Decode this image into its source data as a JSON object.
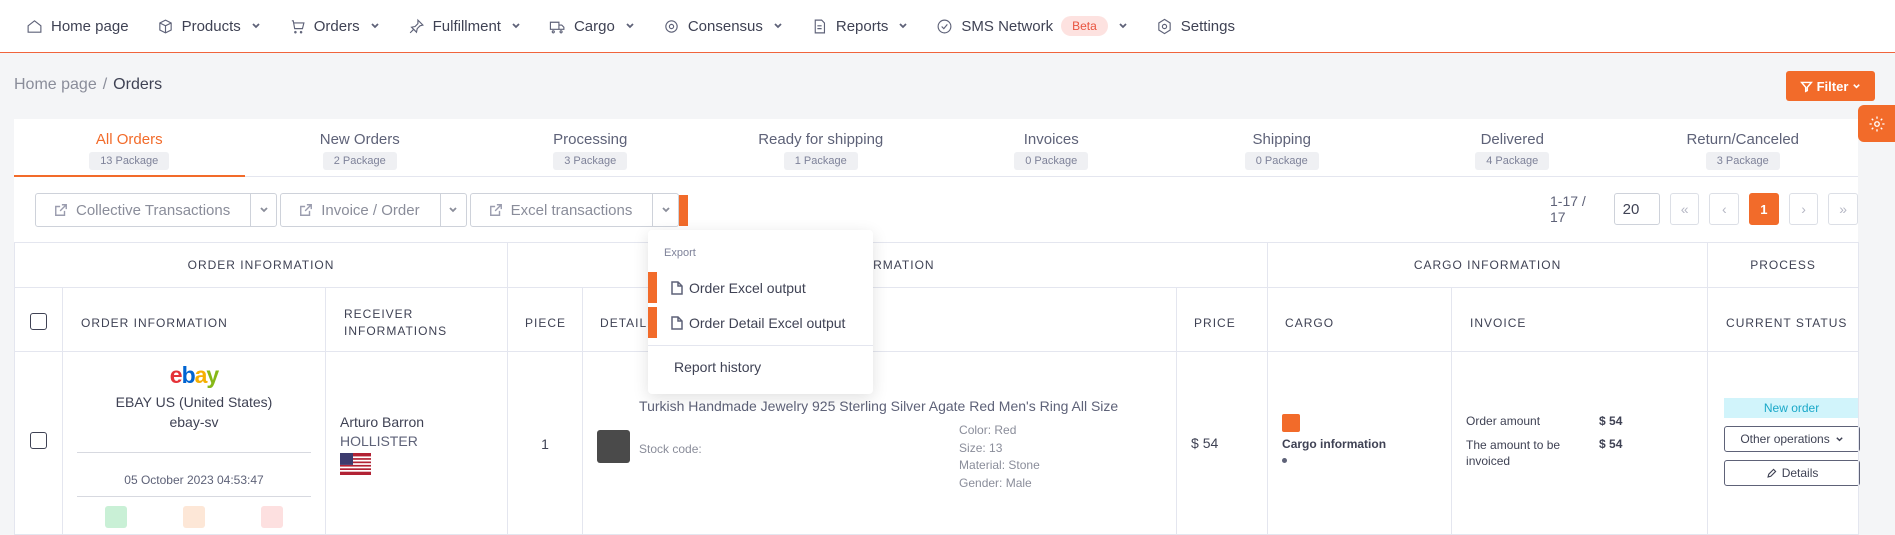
{
  "nav": [
    {
      "label": "Home page",
      "icon": "home-icon",
      "chevron": false
    },
    {
      "label": "Products",
      "icon": "box-icon",
      "chevron": true
    },
    {
      "label": "Orders",
      "icon": "cart-icon",
      "chevron": true
    },
    {
      "label": "Fulfillment",
      "icon": "pin-icon",
      "chevron": true
    },
    {
      "label": "Cargo",
      "icon": "truck-icon",
      "chevron": true
    },
    {
      "label": "Consensus",
      "icon": "target-icon",
      "chevron": true
    },
    {
      "label": "Reports",
      "icon": "report-icon",
      "chevron": true
    },
    {
      "label": "SMS Network",
      "icon": "check-circle-icon",
      "chevron": true,
      "badge": "Beta"
    },
    {
      "label": "Settings",
      "icon": "settings-icon",
      "chevron": false
    }
  ],
  "breadcrumb": {
    "home": "Home page",
    "sep": "/",
    "current": "Orders"
  },
  "filter_label": "Filter",
  "tabs": [
    {
      "label": "All Orders",
      "count": "13 Package",
      "active": true
    },
    {
      "label": "New Orders",
      "count": "2 Package"
    },
    {
      "label": "Processing",
      "count": "3 Package"
    },
    {
      "label": "Ready for shipping",
      "count": "1 Package"
    },
    {
      "label": "Invoices",
      "count": "0 Package"
    },
    {
      "label": "Shipping",
      "count": "0 Package"
    },
    {
      "label": "Delivered",
      "count": "4 Package"
    },
    {
      "label": "Return/Canceled",
      "count": "3 Package"
    }
  ],
  "toolbar": {
    "collective": "Collective Transactions",
    "invoice": "Invoice / Order",
    "excel": "Excel transactions"
  },
  "pager": {
    "range": "1-17 / 17",
    "page_size": "20",
    "first": "«",
    "prev": "‹",
    "current": "1",
    "next": "›",
    "last": "»"
  },
  "table": {
    "groups": {
      "order": "ORDER INFORMATION",
      "product": "INFORMATION",
      "cargo": "CARGO INFORMATION",
      "process": "PROCESS"
    },
    "cols": {
      "order": "ORDER INFORMATION",
      "receiver": "RECEIVER INFORMATIONS",
      "piece": "PIECE",
      "detail": "DETAIL",
      "price": "PRICE",
      "cargo": "CARGO",
      "invoice": "INVOICE",
      "status": "CURRENT STATUS"
    },
    "row": {
      "store_name": "EBAY US (United States)",
      "store_code": "ebay-sv",
      "date": "05 October 2023 04:53:47",
      "receiver_name": "Arturo Barron",
      "receiver_company": "HOLLISTER",
      "piece": "1",
      "product_title": "Turkish Handmade Jewelry 925 Sterling Silver Agate Red Men's Ring All Size",
      "stock_label": "Stock code:",
      "attrs": [
        "Color: Red",
        "Size: 13",
        "Material: Stone",
        "Gender: Male"
      ],
      "price": "$ 54",
      "cargo_label": "Cargo information",
      "order_amount_label": "Order amount",
      "order_amount": "$ 54",
      "invoiced_label": "The amount to be invoiced",
      "invoiced_amount": "$ 54",
      "status": "New order",
      "other_ops": "Other operations",
      "details": "Details"
    }
  },
  "dropdown": {
    "header": "Export",
    "item1": "Order Excel output",
    "item2": "Order Detail Excel output",
    "report": "Report history"
  }
}
